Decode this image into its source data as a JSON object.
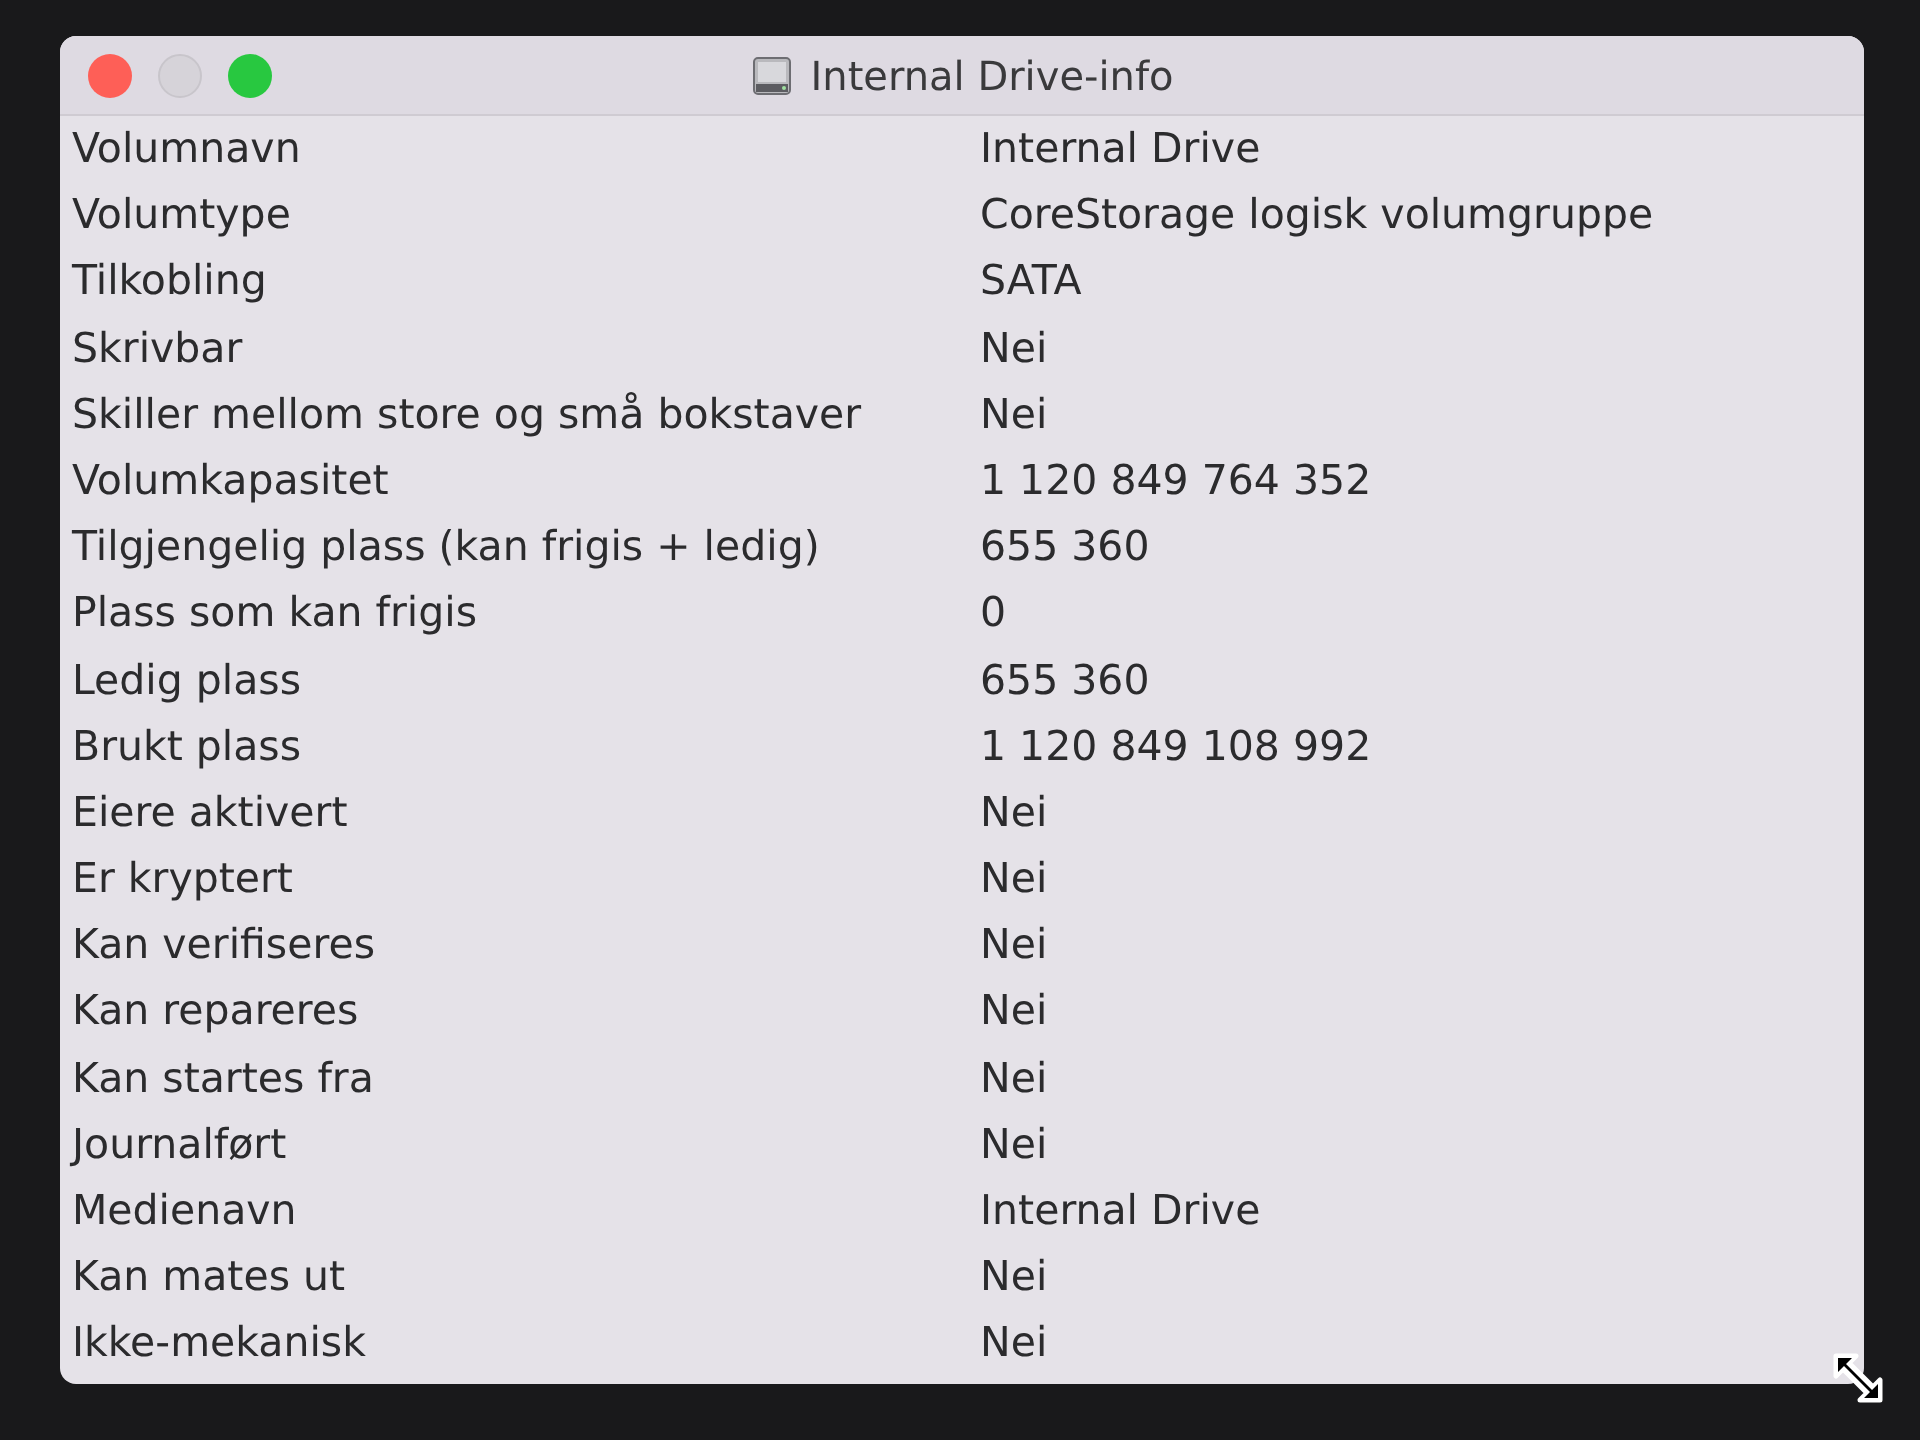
{
  "window": {
    "title": "Internal Drive-info",
    "controls": [
      {
        "kind": "close",
        "disabled": false
      },
      {
        "kind": "minimize",
        "disabled": true
      },
      {
        "kind": "zoom",
        "disabled": false
      }
    ]
  },
  "rows": [
    {
      "label": "Volumnavn",
      "value": "Internal Drive"
    },
    {
      "label": "Volumtype",
      "value": "CoreStorage logisk volumgruppe"
    },
    {
      "label": "Tilkobling",
      "value": "SATA"
    },
    {
      "label": "Skrivbar",
      "value": "Nei"
    },
    {
      "label": "Skiller mellom store og små bokstaver",
      "value": "Nei"
    },
    {
      "label": "Volumkapasitet",
      "value": "1 120 849 764 352"
    },
    {
      "label": "Tilgjengelig plass (kan frigis + ledig)",
      "value": "655 360"
    },
    {
      "label": "Plass som kan frigis",
      "value": "0"
    },
    {
      "label": "Ledig plass",
      "value": "655 360"
    },
    {
      "label": "Brukt plass",
      "value": "1 120 849 108 992"
    },
    {
      "label": "Eiere aktivert",
      "value": "Nei"
    },
    {
      "label": "Er kryptert",
      "value": "Nei"
    },
    {
      "label": "Kan verifiseres",
      "value": "Nei"
    },
    {
      "label": "Kan repareres",
      "value": "Nei"
    },
    {
      "label": "Kan startes fra",
      "value": "Nei"
    },
    {
      "label": "Journalført",
      "value": "Nei"
    },
    {
      "label": "Medienavn",
      "value": "Internal Drive"
    },
    {
      "label": "Kan mates ut",
      "value": "Nei"
    },
    {
      "label": "Ikke-mekanisk",
      "value": "Nei"
    }
  ]
}
